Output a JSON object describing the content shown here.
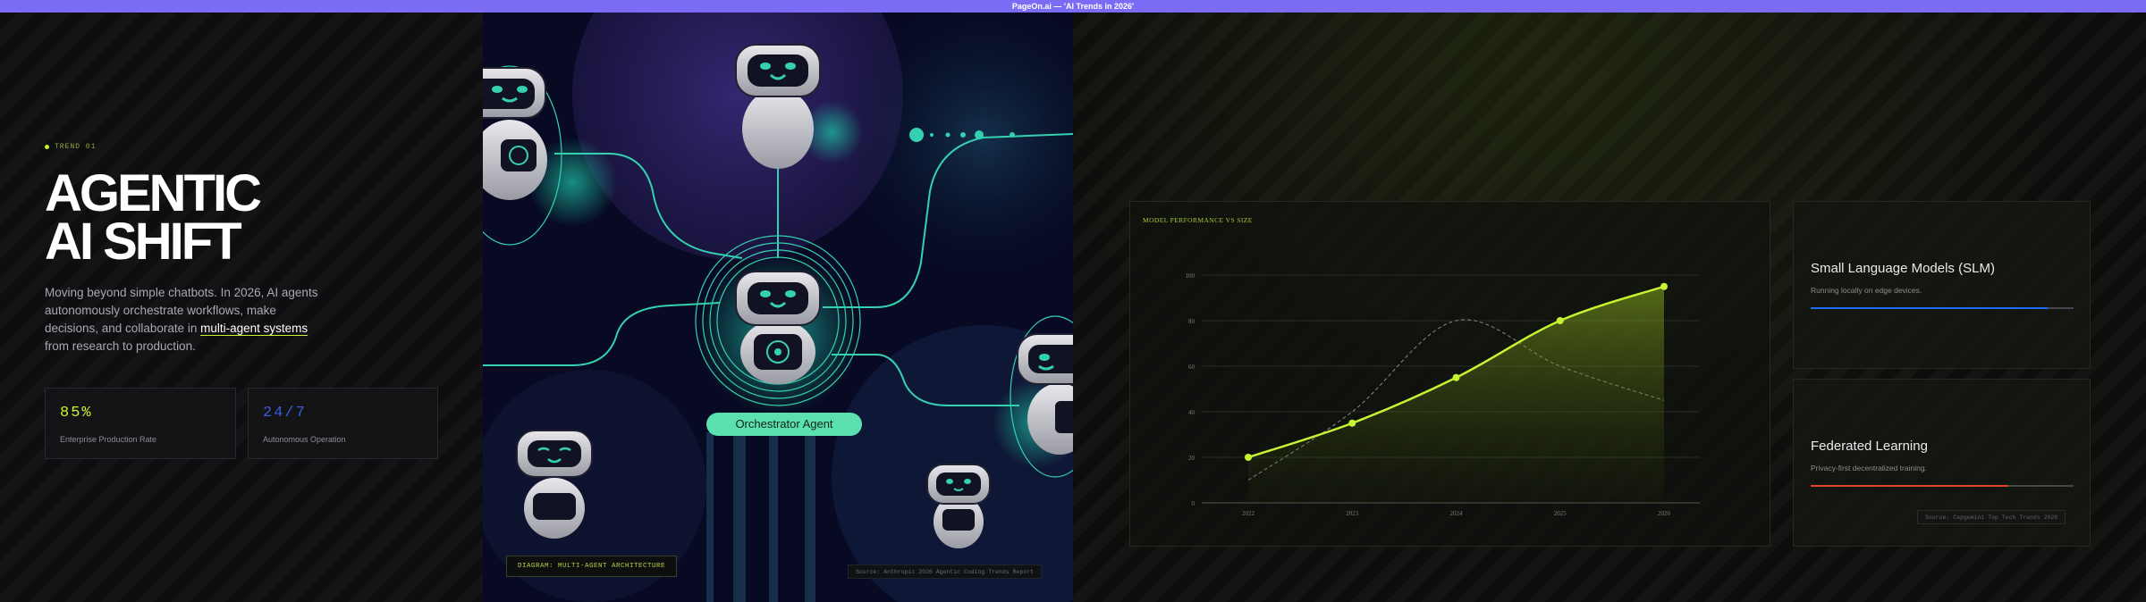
{
  "window": {
    "title": "PageOn.ai — 'AI Trends in 2026'"
  },
  "left": {
    "eyebrow": "TREND 01",
    "headline_line1": "AGENTIC",
    "headline_line2": "AI SHIFT",
    "body_before": "Moving beyond simple chatbots. In 2026, AI agents autonomously orchestrate workflows, make decisions, and collaborate in ",
    "body_highlight": "multi-agent systems",
    "body_after": " from research to production.",
    "stats": [
      {
        "value": "85%",
        "label": "Enterprise Production Rate",
        "color": "#c6f432"
      },
      {
        "value": "24/7",
        "label": "Autonomous Operation",
        "color": "#3b5bd9"
      }
    ]
  },
  "illustration": {
    "badge": "Orchestrator Agent",
    "tag": "DIAGRAM: MULTI-AGENT ARCHITECTURE",
    "source": "Source: Anthropic 2026 Agentic Coding Trends Report"
  },
  "chart_data": {
    "type": "line",
    "title": "MODEL PERFORMANCE VS SIZE",
    "x": [
      "2022",
      "2023",
      "2024",
      "2025",
      "2026"
    ],
    "yticks": [
      0,
      20,
      40,
      60,
      80,
      100
    ],
    "ylim": [
      0,
      100
    ],
    "series": [
      {
        "values": [
          20,
          35,
          55,
          80,
          95
        ],
        "color": "#c6f432",
        "style": "solid-area"
      },
      {
        "values": [
          10,
          40,
          80,
          60,
          45
        ],
        "color": "#8a8a8a",
        "style": "dashed"
      }
    ],
    "grid": true
  },
  "cards": [
    {
      "title": "Small Language Models (SLM)",
      "desc": "Running locally on edge devices.",
      "progress": 0.9,
      "color": "#1e6bff"
    },
    {
      "title": "Federated Learning",
      "desc": "Privacy-first decentralized training.",
      "progress": 0.75,
      "color": "#e8422e"
    }
  ],
  "right_source": "Source: Capgemini Top Tech Trends 2026"
}
